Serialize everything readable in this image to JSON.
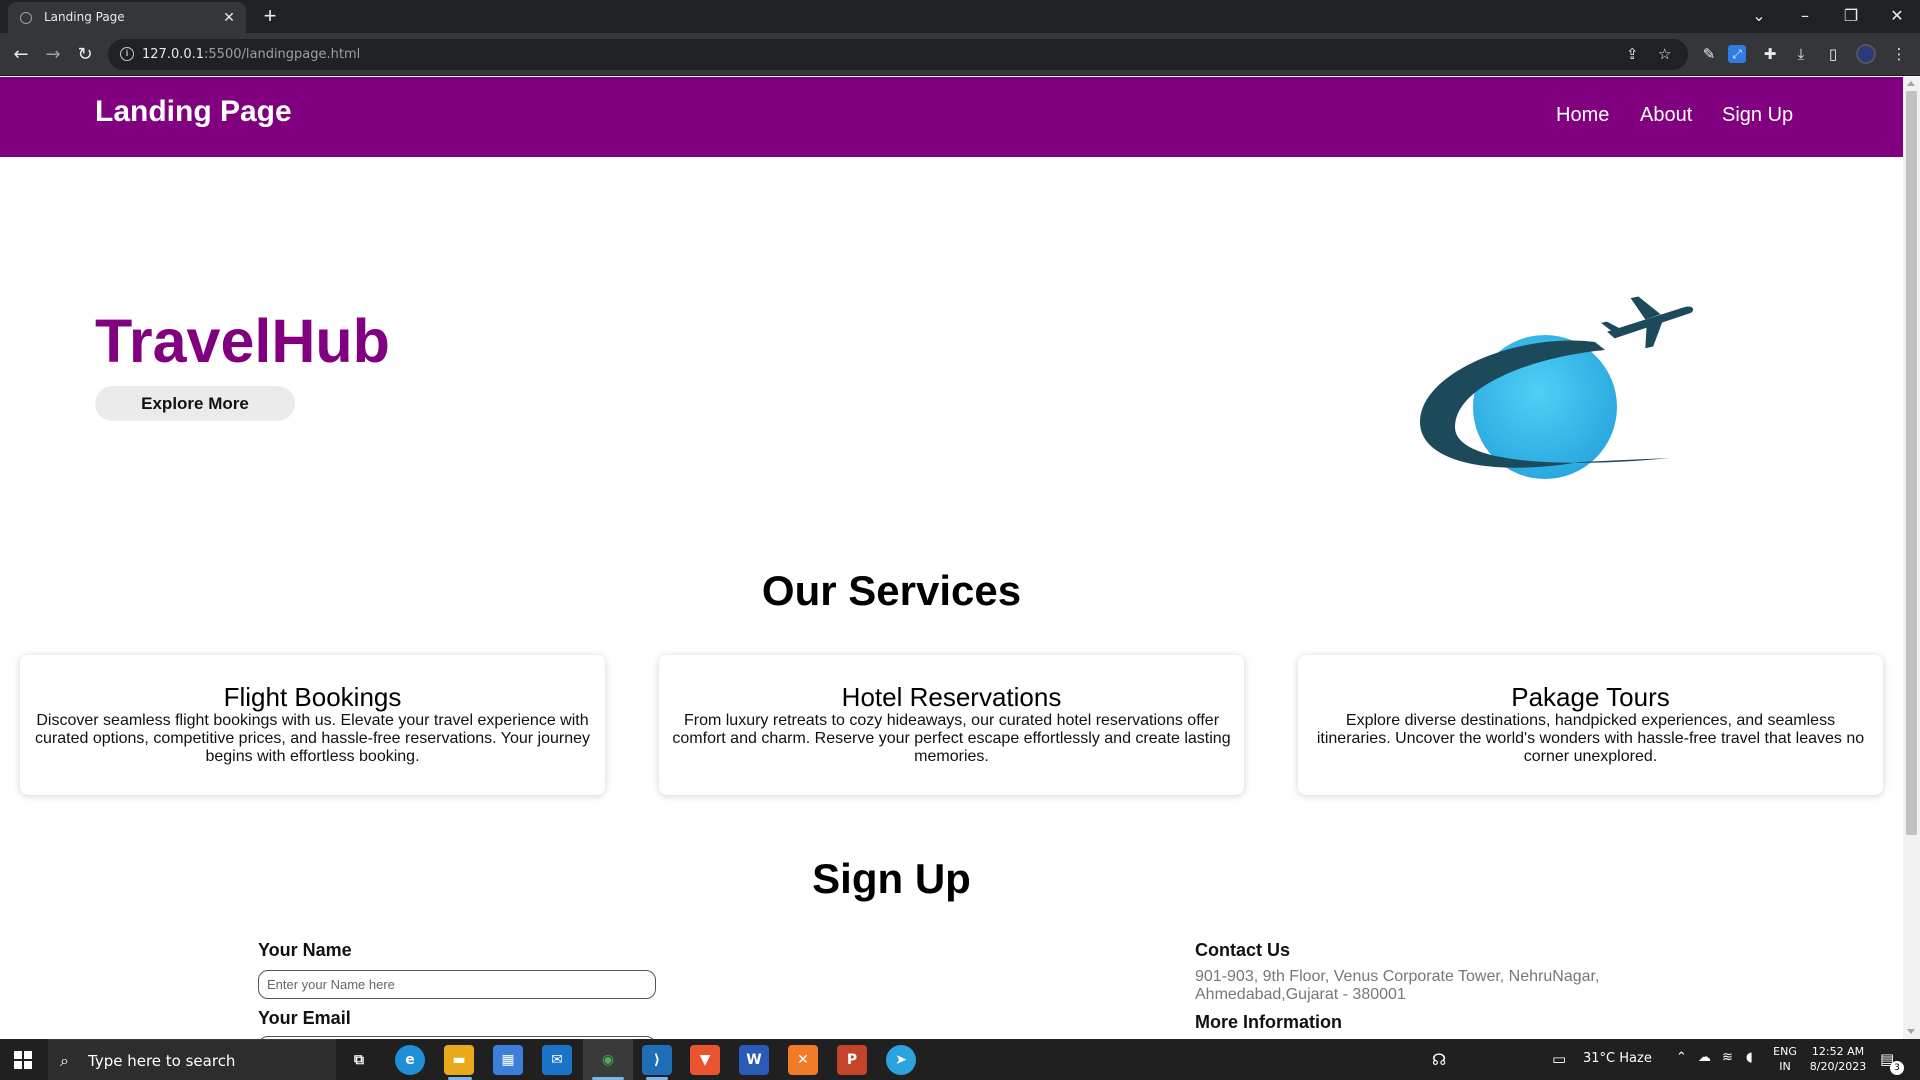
{
  "browser": {
    "tab_title": "Landing Page",
    "url_host": "127.0.0.1",
    "url_path": ":5500/landingpage.html",
    "tab_close": "✕",
    "new_tab": "+",
    "window": {
      "chevron": "⌄",
      "minimize": "–",
      "restore": "❐",
      "close": "✕"
    },
    "nav": {
      "back": "←",
      "forward": "→",
      "reload": "↻",
      "info": "i"
    },
    "omnibox_icons": {
      "share": "⇪",
      "bookmark": "☆"
    }
  },
  "site": {
    "brand": "Landing Page",
    "nav": [
      "Home",
      "About",
      "Sign Up"
    ],
    "hero": {
      "title": "TravelHub",
      "button": "Explore More"
    },
    "services": {
      "title": "Our Services",
      "cards": [
        {
          "title": "Flight Bookings",
          "text": "Discover seamless flight bookings with us. Elevate your travel experience with curated options, competitive prices, and hassle-free reservations. Your journey begins with effortless booking."
        },
        {
          "title": "Hotel Reservations",
          "text": "From luxury retreats to cozy hideaways, our curated hotel reservations offer comfort and charm. Reserve your perfect escape effortlessly and create lasting memories."
        },
        {
          "title": "Pakage Tours",
          "text": "Explore diverse destinations, handpicked experiences, and seamless itineraries. Uncover the world's wonders with hassle-free travel that leaves no corner unexplored."
        }
      ]
    },
    "signup": {
      "title": "Sign Up",
      "name_label": "Your Name",
      "name_placeholder": "Enter your Name here",
      "email_label": "Your Email"
    },
    "contact": {
      "title": "Contact Us",
      "address_line1": "901-903, 9th Floor, Venus Corporate Tower, NehruNagar,",
      "address_line2": "Ahmedabad,Gujarat - 380001",
      "more_title": "More Information"
    }
  },
  "taskbar": {
    "search_placeholder": "Type here to search",
    "search_icon": "⌕",
    "apps": [
      {
        "name": "task-view",
        "glyph": "⧉",
        "color": "#202020"
      },
      {
        "name": "edge",
        "glyph": "e",
        "color": "#1f8fd6"
      },
      {
        "name": "file-explorer",
        "glyph": "▬",
        "color": "#e8a91a"
      },
      {
        "name": "store",
        "glyph": "▦",
        "color": "#3c7fd8"
      },
      {
        "name": "mail",
        "glyph": "✉",
        "color": "#1c74c9"
      },
      {
        "name": "chrome",
        "glyph": "◉",
        "color": "#3a3a3a"
      },
      {
        "name": "vscode",
        "glyph": "⟩",
        "color": "#1f6fb8"
      },
      {
        "name": "brave",
        "glyph": "▼",
        "color": "#e8542e"
      },
      {
        "name": "word",
        "glyph": "W",
        "color": "#2b5bb8"
      },
      {
        "name": "xampp",
        "glyph": "✕",
        "color": "#f27b2a"
      },
      {
        "name": "powerpoint",
        "glyph": "P",
        "color": "#c4432b"
      },
      {
        "name": "telegram",
        "glyph": "➤",
        "color": "#2aa3de"
      }
    ],
    "people_icon": "☊",
    "weather": "31°C  Haze",
    "lang_top": "ENG",
    "lang_bottom": "IN",
    "time": "12:52 AM",
    "date": "8/20/2023",
    "notifications": "3"
  }
}
